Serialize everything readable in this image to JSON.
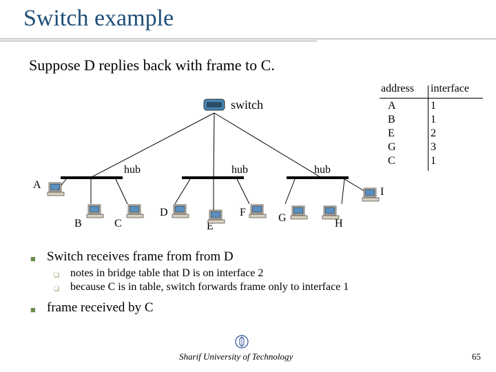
{
  "title": "Switch example",
  "subtitle": "Suppose D replies back with frame to C.",
  "switch_label": "switch",
  "hubs": {
    "h1": "hub",
    "h2": "hub",
    "h3": "hub"
  },
  "nodes": {
    "A": "A",
    "B": "B",
    "C": "C",
    "D": "D",
    "E": "E",
    "F": "F",
    "G": "G",
    "H": "H",
    "I": "I"
  },
  "table": {
    "head": {
      "addr": "address",
      "iface": "interface"
    },
    "rows": [
      {
        "addr": "A",
        "iface": "1"
      },
      {
        "addr": "B",
        "iface": "1"
      },
      {
        "addr": "E",
        "iface": "2"
      },
      {
        "addr": "G",
        "iface": "3"
      },
      {
        "addr": "C",
        "iface": "1"
      }
    ]
  },
  "bullets": {
    "b1": "Switch receives frame from from D",
    "b1a": "notes in bridge table that D is on interface 2",
    "b1b": "because C is in table, switch forwards frame only to interface 1",
    "b2": "frame received by C"
  },
  "footer": "Sharif University of Technology",
  "page": "65"
}
